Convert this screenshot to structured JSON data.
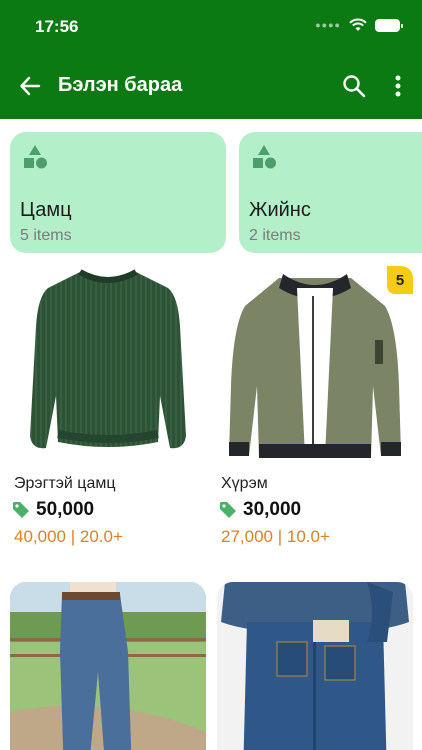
{
  "status_bar": {
    "time": "17:56"
  },
  "header": {
    "title": "Бэлэн бараа"
  },
  "categories": [
    {
      "name": "Цамц",
      "count": "5 items"
    },
    {
      "name": "Жийнс",
      "count": "2 items"
    }
  ],
  "products": [
    {
      "name": "Эрэгтэй цамц",
      "price": "50,000",
      "wholesale": "40,000 | 20.0+",
      "image": "green-sweater"
    },
    {
      "name": "Хүрэм",
      "price": "30,000",
      "wholesale": "27,000 | 10.0+",
      "image": "olive-bomber-jacket",
      "badge": "5"
    },
    {
      "name": "",
      "price": "",
      "wholesale": "",
      "image": "jeans-photo-outdoor"
    },
    {
      "name": "",
      "price": "",
      "wholesale": "",
      "image": "jeans-photo-studio"
    }
  ],
  "colors": {
    "primary": "#0c7a12",
    "category_bg": "#b3f0c9",
    "wholesale": "#d98324",
    "badge": "#f6cb14"
  }
}
